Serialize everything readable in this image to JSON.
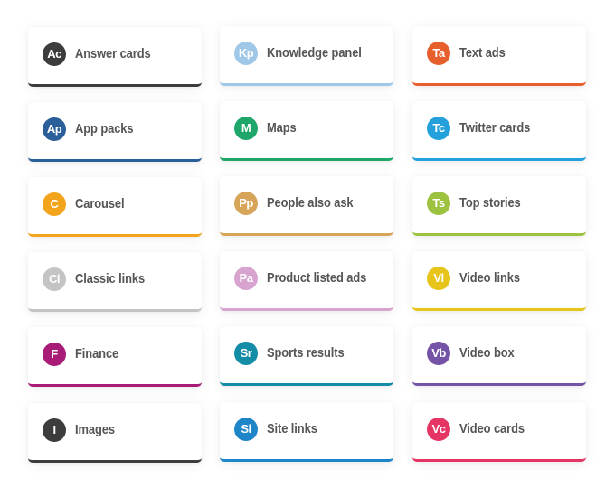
{
  "cards": [
    {
      "abbr": "Ac",
      "label": "Answer cards",
      "color": "#3c3c3c"
    },
    {
      "abbr": "Kp",
      "label": "Knowledge panel",
      "color": "#9fc7e8"
    },
    {
      "abbr": "Ta",
      "label": "Text ads",
      "color": "#e85f2e"
    },
    {
      "abbr": "Ap",
      "label": "App packs",
      "color": "#2a5f9a"
    },
    {
      "abbr": "M",
      "label": "Maps",
      "color": "#1fa66b"
    },
    {
      "abbr": "Tc",
      "label": "Twitter cards",
      "color": "#24a0dc"
    },
    {
      "abbr": "C",
      "label": "Carousel",
      "color": "#f2a51c"
    },
    {
      "abbr": "Pp",
      "label": "People also ask",
      "color": "#d6a55a"
    },
    {
      "abbr": "Ts",
      "label": "Top stories",
      "color": "#9cc23f"
    },
    {
      "abbr": "Cl",
      "label": "Classic links",
      "color": "#c4c4c4"
    },
    {
      "abbr": "Pa",
      "label": "Product listed ads",
      "color": "#d9a3cf"
    },
    {
      "abbr": "Vl",
      "label": "Video links",
      "color": "#e6c419"
    },
    {
      "abbr": "F",
      "label": "Finance",
      "color": "#a81c78"
    },
    {
      "abbr": "Sr",
      "label": "Sports results",
      "color": "#138ca6"
    },
    {
      "abbr": "Vb",
      "label": "Video box",
      "color": "#7554a7"
    },
    {
      "abbr": "I",
      "label": "Images",
      "color": "#3c3c3c"
    },
    {
      "abbr": "Sl",
      "label": "Site links",
      "color": "#1e86c8"
    },
    {
      "abbr": "Vc",
      "label": "Video cards",
      "color": "#e53564"
    }
  ]
}
